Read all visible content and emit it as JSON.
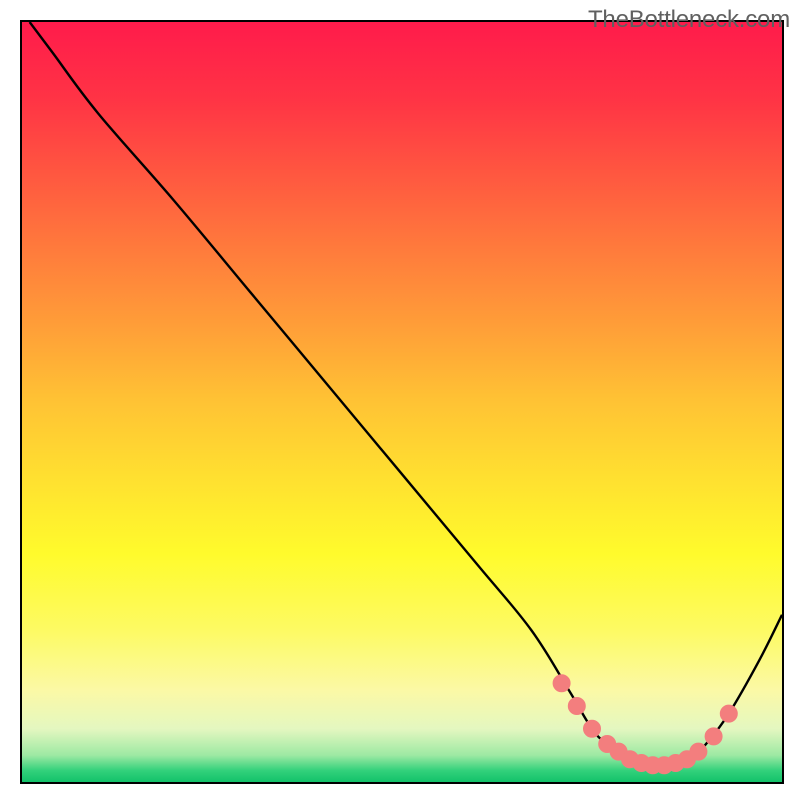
{
  "watermark": "TheBottleneck.com",
  "colors": {
    "border": "#000000",
    "line": "#000000",
    "marker_fill": "#f37e7e",
    "marker_stroke": "#f37e7e"
  },
  "chart_data": {
    "type": "line",
    "title": "",
    "xlabel": "",
    "ylabel": "",
    "xlim": [
      0,
      100
    ],
    "ylim": [
      0,
      100
    ],
    "grid": false,
    "legend": false,
    "gradient_stops": [
      {
        "offset": 0.0,
        "color": "#ff1b4b"
      },
      {
        "offset": 0.1,
        "color": "#ff3345"
      },
      {
        "offset": 0.2,
        "color": "#ff5740"
      },
      {
        "offset": 0.3,
        "color": "#ff7b3c"
      },
      {
        "offset": 0.4,
        "color": "#ff9e38"
      },
      {
        "offset": 0.5,
        "color": "#ffc334"
      },
      {
        "offset": 0.6,
        "color": "#ffe030"
      },
      {
        "offset": 0.7,
        "color": "#fffb2c"
      },
      {
        "offset": 0.8,
        "color": "#fdfa63"
      },
      {
        "offset": 0.88,
        "color": "#fbf9a6"
      },
      {
        "offset": 0.93,
        "color": "#e4f7c0"
      },
      {
        "offset": 0.965,
        "color": "#9de9a3"
      },
      {
        "offset": 0.985,
        "color": "#32d17b"
      },
      {
        "offset": 1.0,
        "color": "#13c26a"
      }
    ],
    "series": [
      {
        "name": "bottleneck-curve",
        "x": [
          1,
          4,
          10,
          20,
          30,
          40,
          50,
          60,
          67,
          72,
          75,
          77,
          80,
          84,
          88,
          90,
          93,
          97,
          100
        ],
        "y": [
          100,
          96,
          88,
          76.5,
          64.5,
          52.5,
          40.5,
          28.5,
          20,
          12,
          7,
          5,
          3,
          2,
          3,
          5,
          9,
          16,
          22
        ]
      }
    ],
    "markers": {
      "name": "highlight-region",
      "x": [
        71,
        73,
        75,
        77,
        78.5,
        80,
        81.5,
        83,
        84.5,
        86,
        87.5,
        89,
        91,
        93
      ],
      "y": [
        13,
        10,
        7,
        5,
        4,
        3,
        2.5,
        2.2,
        2.2,
        2.5,
        3,
        4,
        6,
        9
      ]
    },
    "annotations": []
  }
}
